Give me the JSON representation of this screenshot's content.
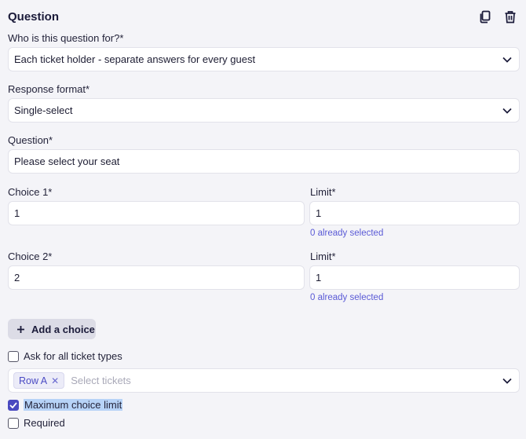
{
  "header": {
    "title": "Question",
    "copy_icon": "copy-icon",
    "delete_icon": "trash-icon"
  },
  "audience": {
    "label": "Who is this question for?*",
    "value": "Each ticket holder - separate answers for every guest"
  },
  "format": {
    "label": "Response format*",
    "value": "Single-select"
  },
  "question": {
    "label": "Question*",
    "value": "Please select your seat"
  },
  "choices": [
    {
      "label": "Choice 1*",
      "value": "1",
      "limit_label": "Limit*",
      "limit_value": "1",
      "helper": "0 already selected"
    },
    {
      "label": "Choice 2*",
      "value": "2",
      "limit_label": "Limit*",
      "limit_value": "1",
      "helper": "0 already selected"
    }
  ],
  "add_choice": {
    "label": "Add a choice"
  },
  "ask_all": {
    "label": "Ask for all ticket types",
    "checked": false
  },
  "tickets": {
    "tag": "Row A",
    "placeholder": "Select tickets"
  },
  "max_limit": {
    "label": "Maximum choice limit",
    "checked": true
  },
  "required": {
    "label": "Required",
    "checked": false
  },
  "colors": {
    "accent": "#4a4ac0",
    "helper": "#5a5ad6",
    "background": "#f4f4f8"
  }
}
